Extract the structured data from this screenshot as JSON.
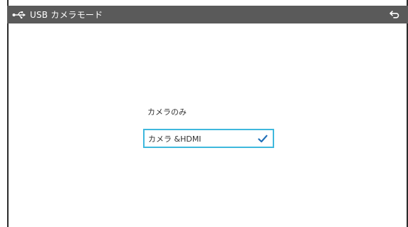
{
  "header": {
    "title": "USB カメラモード",
    "icons": {
      "usb": "usb-icon",
      "back": "back-arrow-icon"
    }
  },
  "options": [
    {
      "label": "カメラのみ",
      "selected": false
    },
    {
      "label": "カメラ &HDMI",
      "selected": true,
      "check_icon": "check-icon"
    }
  ],
  "colors": {
    "header_bg": "#5a5a5a",
    "selection_border": "#3fb8dd",
    "check": "#1f6fb8"
  }
}
